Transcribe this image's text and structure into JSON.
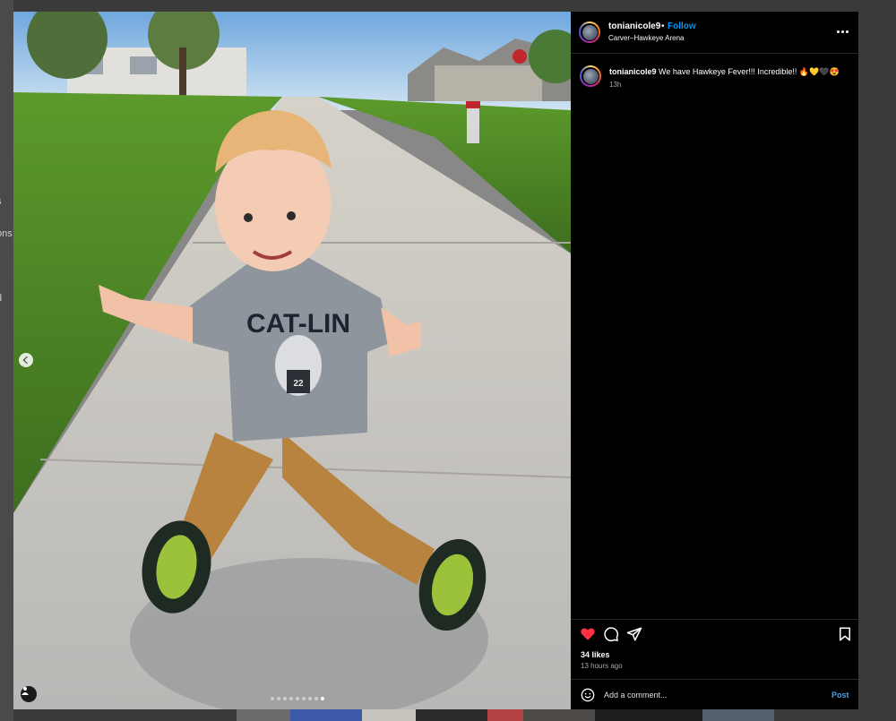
{
  "sidebar_fragments": [
    "s",
    "ons",
    "d"
  ],
  "post": {
    "username": "tonianicole9",
    "separator": "•",
    "follow_label": "Follow",
    "location": "Carver–Hawkeye Arena",
    "caption_text": " We have Hawkeye Fever!!! Incredible!! 🔥💛🖤😍",
    "caption_time": "13h",
    "likes": "34 likes",
    "time_ago": "13 hours ago",
    "comment_placeholder": "Add a comment...",
    "post_label": "Post"
  },
  "carousel": {
    "total": 9,
    "active_index": 8
  },
  "photo": {
    "shirt_text": "CAT-LIN",
    "jersey_number": "22"
  },
  "colors": {
    "like": "#ff3040",
    "follow": "#0095f6",
    "post": "#4a9ee6"
  },
  "icons": [
    "chevron-left-icon",
    "user-tag-icon",
    "more-icon",
    "heart-icon",
    "comment-icon",
    "share-icon",
    "bookmark-icon",
    "emoji-icon"
  ]
}
